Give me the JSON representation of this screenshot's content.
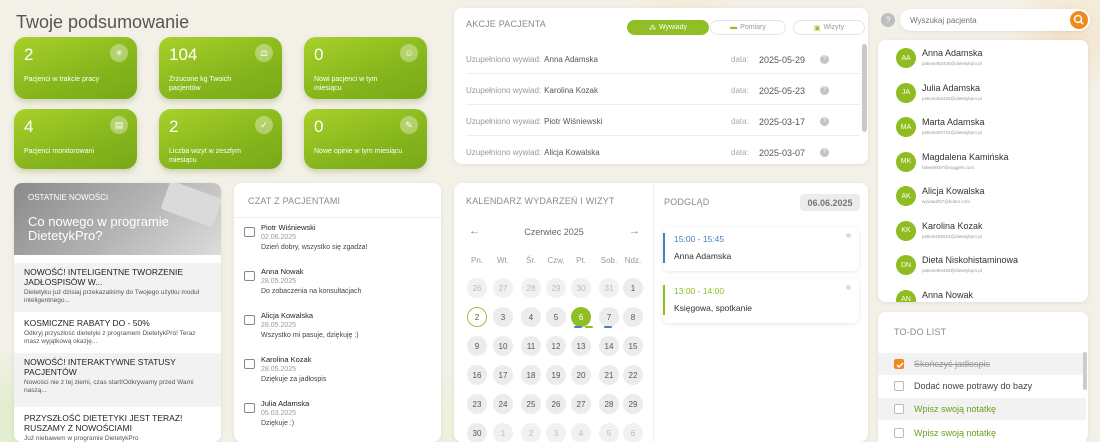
{
  "title": "Twoje podsumowanie",
  "tiles": [
    {
      "value": "2",
      "label": "Pacjenci w trakcie pracy",
      "icon": "sparkle-icon"
    },
    {
      "value": "104",
      "label": "Zrzucone kg Twoich pacjentów",
      "icon": "scale-icon"
    },
    {
      "value": "0",
      "label": "Nowi pacjenci w tym miesiącu",
      "icon": "user-add-icon"
    },
    {
      "value": "4",
      "label": "Pacjenci monitorowani",
      "icon": "report-icon"
    },
    {
      "value": "2",
      "label": "Liczba wizyt w zeszłym miesiącu",
      "icon": "check-icon"
    },
    {
      "value": "0",
      "label": "Nowe opinie w tym miesiącu",
      "icon": "review-icon"
    }
  ],
  "actions": {
    "header": "AKCJE PACJENTA",
    "tabs": [
      {
        "label": "Wywiady",
        "glyph": "⁂"
      },
      {
        "label": "Pomiary",
        "glyph": "▬"
      },
      {
        "label": "Wizyty",
        "glyph": "▣"
      }
    ],
    "rows": [
      {
        "prefix": "Uzupełniono wywiad:",
        "name": "Anna Adamska",
        "date_label": "data:",
        "date": "2025-05-29"
      },
      {
        "prefix": "Uzupełniono wywiad:",
        "name": "Karolina Kozak",
        "date_label": "data:",
        "date": "2025-05-23"
      },
      {
        "prefix": "Uzupełniono wywiad:",
        "name": "Piotr Wiśniewski",
        "date_label": "data:",
        "date": "2025-03-17"
      },
      {
        "prefix": "Uzupełniono wywiad:",
        "name": "Alicja Kowalska",
        "date_label": "data:",
        "date": "2025-03-07"
      }
    ]
  },
  "search": {
    "placeholder": "Wyszukaj pacjenta",
    "help": "?"
  },
  "patients": [
    {
      "initials": "AA",
      "name": "Anna Adamska",
      "email": "patient462436@dietetykpro.pl"
    },
    {
      "initials": "JA",
      "name": "Julia Adamska",
      "email": "patient462435@dietetykpro.pl"
    },
    {
      "initials": "MA",
      "name": "Marta Adamska",
      "email": "patient420722@dietetykpro.pl"
    },
    {
      "initials": "MK",
      "name": "Magdalena Kamińska",
      "email": "fakeie9197@suggets.com"
    },
    {
      "initials": "AK",
      "name": "Alicja Kowalska",
      "email": "wywiad257@kobro.com"
    },
    {
      "initials": "KK",
      "name": "Karolina Kozak",
      "email": "patient185623@dietetykpro.pl"
    },
    {
      "initials": "DN",
      "name": "Dieta Niskohistaminowa",
      "email": "patient494483@dietetykpro.pl"
    },
    {
      "initials": "AN",
      "name": "Anna Nowak",
      "email": ""
    }
  ],
  "news": {
    "header": "OSTATNIE NOWOŚCI",
    "hero": "Co nowego w programie DietetykPro?",
    "items": [
      {
        "title": "NOWOŚĆ! INTELIGENTNE TWORZENIE JADŁOSPISÓW W...",
        "desc": "Dietetyku już dzisiaj przekazaliśmy do Twojego użytku moduł inteligentnego..."
      },
      {
        "title": "KOSMICZNE RABATY DO - 50%",
        "desc": "Odkryj przyszłość dietetyki z programem DietetykPro! Teraz masz wyjątkową okazję..."
      },
      {
        "title": "NOWOŚĆ! INTERAKTYWNE STATUSY PACJENTÓW",
        "desc": "Nowości nie z tej ziemi, czas start!Odkrywamy przed Wami naszą..."
      },
      {
        "title": "PRZYSZŁOŚĆ DIETETYKI JEST TERAZ! RUSZAMY Z NOWOŚCIAMI",
        "desc": "Już niebawem w programie DietetykPro"
      }
    ]
  },
  "chat": {
    "header": "CZAT Z PACJENTAMI",
    "items": [
      {
        "name": "Piotr Wiśniewski",
        "date": "02.06.2025",
        "msg": "Dzień dobry, wszystko się zgadza!"
      },
      {
        "name": "Anna Nowak",
        "date": "28.05.2025",
        "msg": "Do zobaczenia na konsultacjach"
      },
      {
        "name": "Alicja Kowalska",
        "date": "28.05.2025",
        "msg": "Wszystko mi pasuje, dziękuję :)"
      },
      {
        "name": "Karolina Kozak",
        "date": "28.05.2025",
        "msg": "Dziękuje za jadłospis"
      },
      {
        "name": "Julia Adamska",
        "date": "05.03.2025",
        "msg": "Dziękuje :)"
      }
    ]
  },
  "calendar": {
    "header": "KALENDARZ WYDARZEŃ I WIZYT",
    "month": "Czerwiec 2025",
    "prev": "←",
    "next": "→",
    "weekdays": [
      "Pn.",
      "Wt.",
      "Śr.",
      "Czw.",
      "Pt.",
      "Sob.",
      "Ndz."
    ],
    "weeks": [
      [
        "26",
        "27",
        "28",
        "29",
        "30",
        "31",
        "1"
      ],
      [
        "2",
        "3",
        "4",
        "5",
        "6",
        "7",
        "8"
      ],
      [
        "9",
        "10",
        "11",
        "12",
        "13",
        "14",
        "15"
      ],
      [
        "16",
        "17",
        "18",
        "19",
        "20",
        "21",
        "22"
      ],
      [
        "23",
        "24",
        "25",
        "26",
        "27",
        "28",
        "29"
      ],
      [
        "30",
        "1",
        "2",
        "3",
        "4",
        "5",
        "6"
      ]
    ]
  },
  "preview": {
    "header": "PODGLĄD",
    "date": "06.06.2025",
    "events": [
      {
        "time": "15:00 - 15:45",
        "title": "Anna Adamska",
        "color": "#4a7fc1"
      },
      {
        "time": "13:00 - 14:00",
        "title": "Księgowa, spotkanie",
        "color": "#8fbf24"
      }
    ]
  },
  "todo": {
    "header": "TO-DO LIST",
    "items": [
      {
        "text": "Skończyć jadłospis",
        "done": true
      },
      {
        "text": "Dodać nowe potrawy do bazy",
        "done": false
      },
      {
        "text": "Wpisz swoją notatkę",
        "done": false
      },
      {
        "text": "Wpisz swoją notatkę",
        "done": false
      }
    ]
  },
  "colors": {
    "accent": "#8fbf24",
    "search": "#f08a1c"
  }
}
